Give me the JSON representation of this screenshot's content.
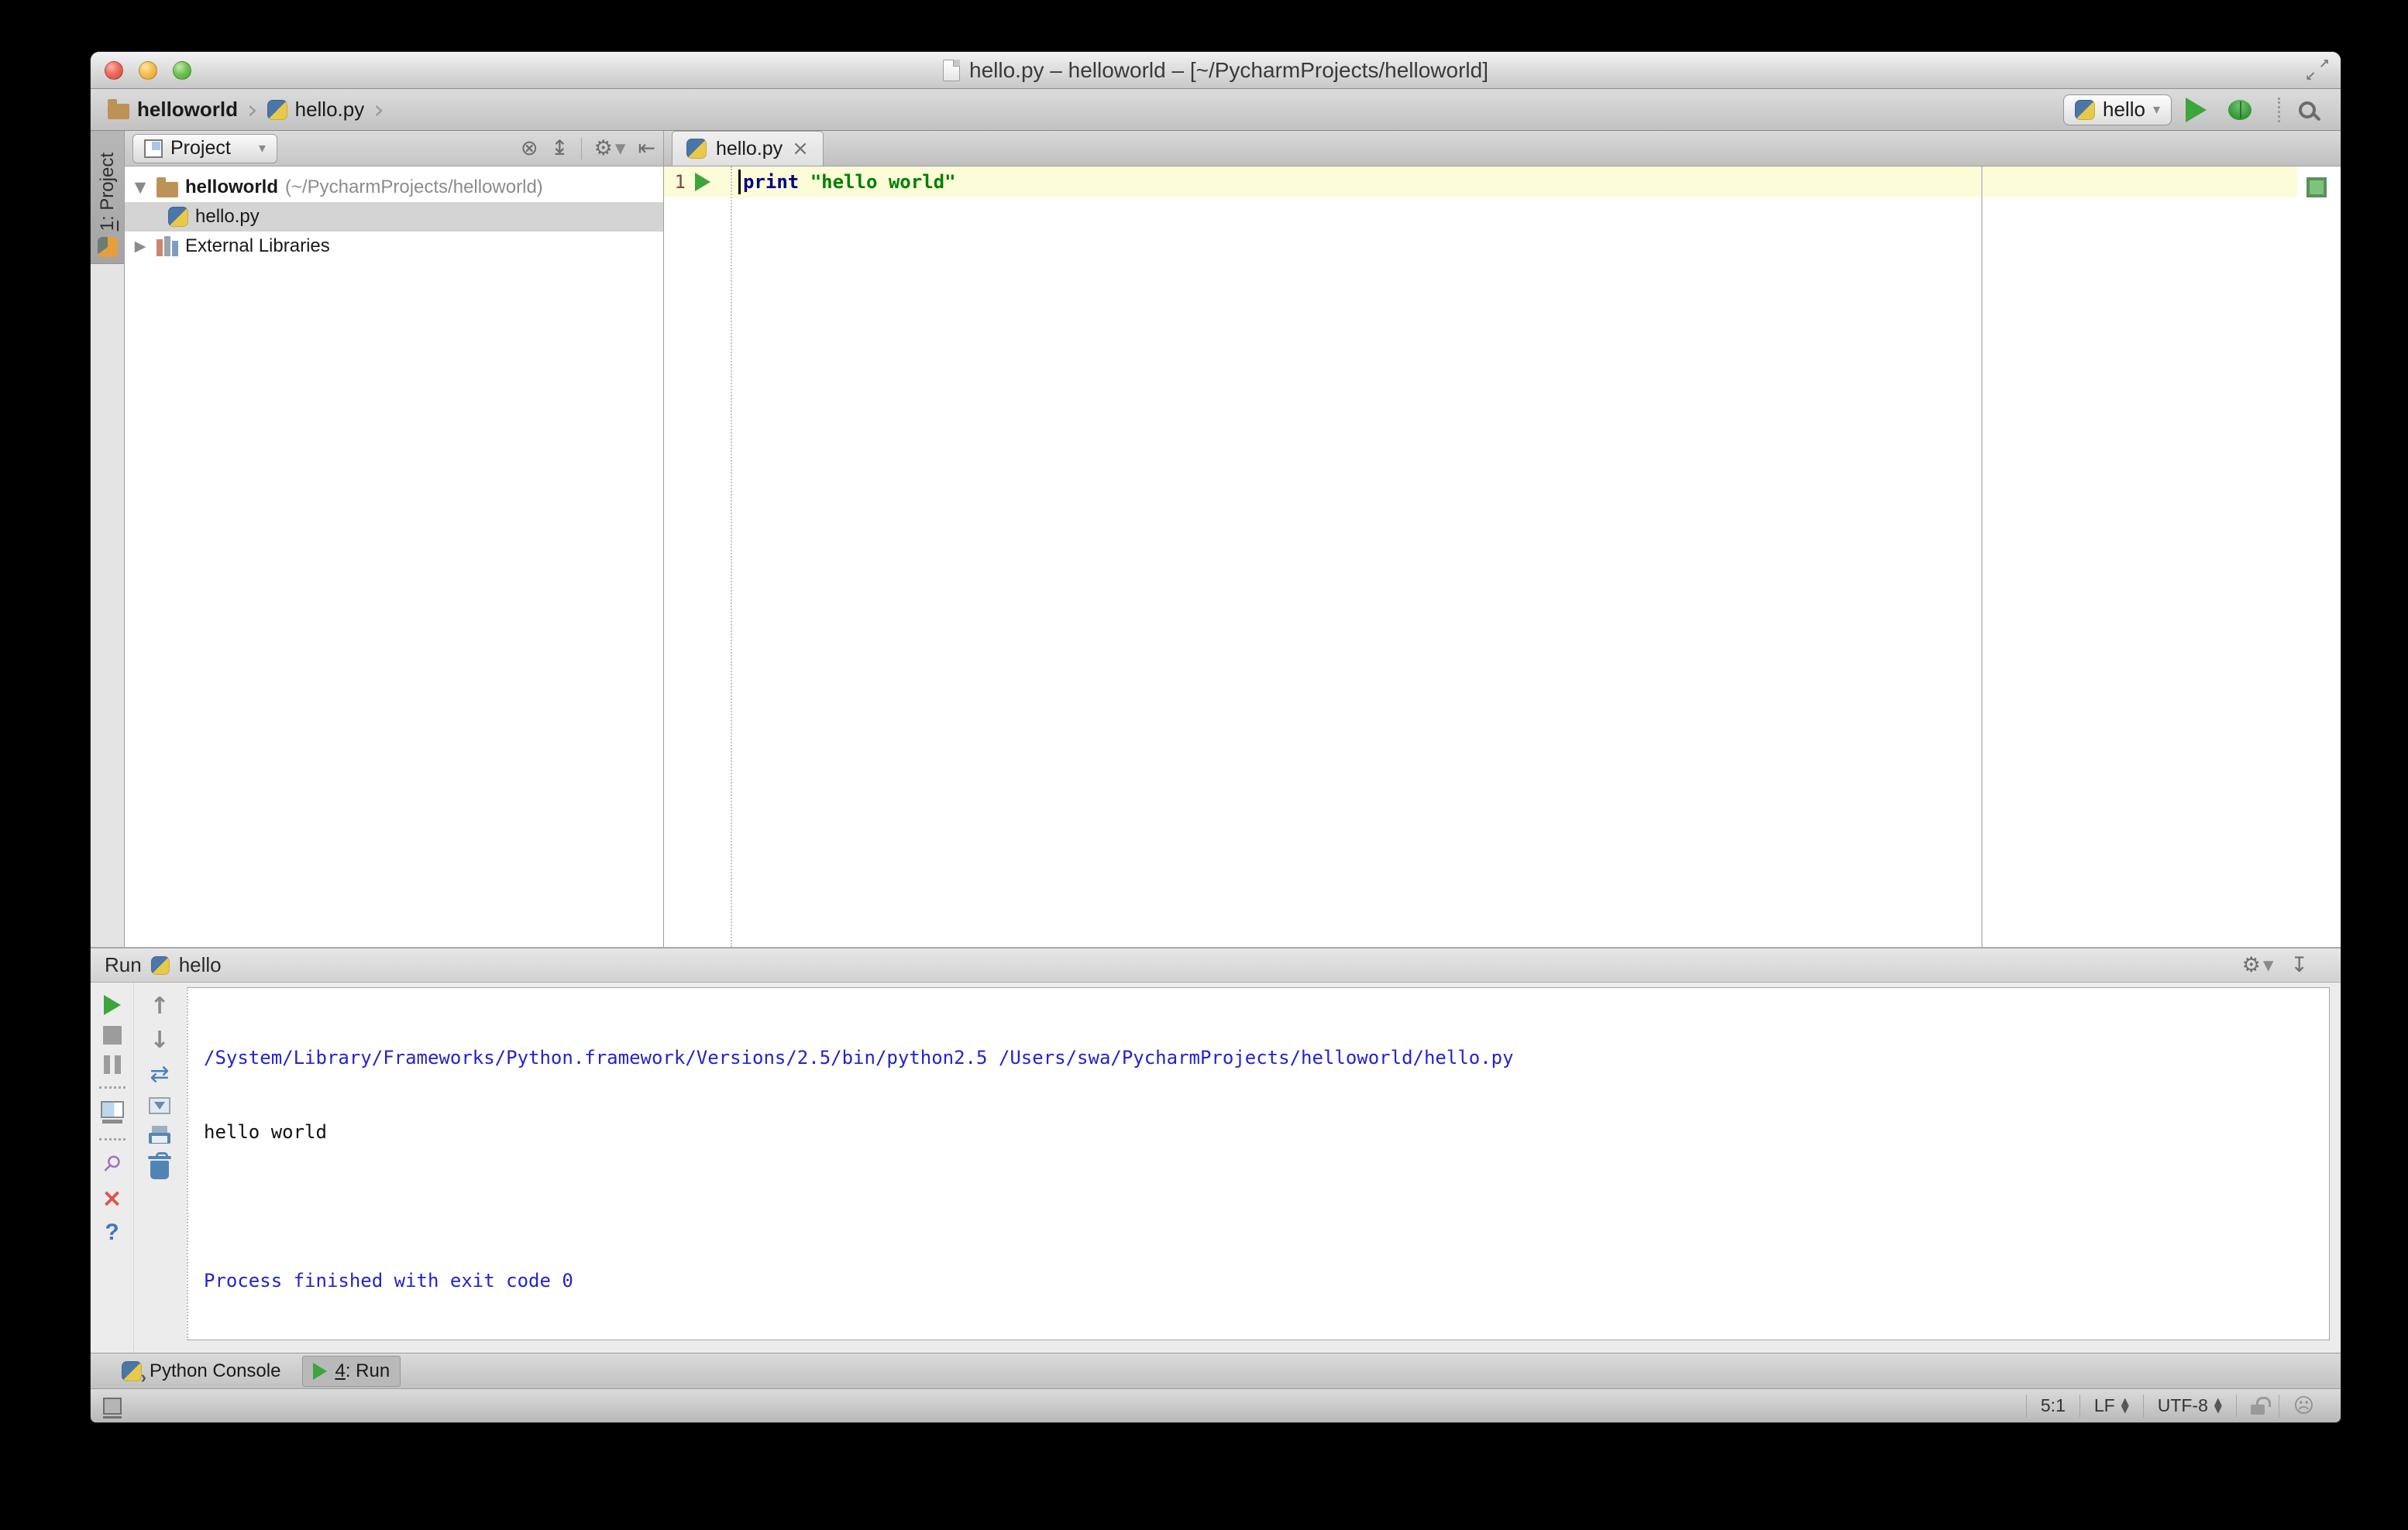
{
  "titlebar": {
    "title": "hello.py – helloworld – [~/PycharmProjects/helloworld]"
  },
  "toolbar": {
    "breadcrumb_project": "helloworld",
    "breadcrumb_file": "hello.py",
    "run_config_name": "hello"
  },
  "left_stripe": {
    "tab_mnemonic": "1",
    "tab_rest": ": Project"
  },
  "project_panel": {
    "title": "Project",
    "tree": {
      "root_name": "helloworld",
      "root_path": "(~/PycharmProjects/helloworld)",
      "file_name": "hello.py",
      "libraries_label": "External Libraries"
    }
  },
  "editor": {
    "tab_label": "hello.py",
    "line_number": "1",
    "code_keyword": "print",
    "code_string": "\"hello world\""
  },
  "run_panel": {
    "title": "Run",
    "config_name": "hello",
    "console": {
      "line1": "/System/Library/Frameworks/Python.framework/Versions/2.5/bin/python2.5 /Users/swa/PycharmProjects/helloworld/hello.py",
      "line2": "hello world",
      "line3": "",
      "line4": "Process finished with exit code 0"
    },
    "help_label": "?"
  },
  "bottom_bar": {
    "python_console_label": "Python Console",
    "run_tab_mnemonic": "4",
    "run_tab_rest": ": Run"
  },
  "status_bar": {
    "caret_position": "5:1",
    "line_separator": "LF",
    "encoding": "UTF-8"
  },
  "icons": {
    "chevron": "›",
    "dropdown": "▾",
    "locate": "⊕",
    "collapse_all": "↨",
    "gear": "⚙",
    "hide_side": "⇤",
    "caret_expanded": "▼",
    "caret_collapsed": "▶",
    "close": "×",
    "dock_down": "↧",
    "arrow_up": "↑",
    "arrow_down": "↓",
    "soft_wrap": "⇄",
    "pin": "⚲",
    "inspector_face": "☹",
    "tri_up": "▲",
    "tri_down": "▼",
    "arrow_ne": "↗",
    "arrow_sw": "↙"
  },
  "colors": {
    "run_green": "#3CA53C",
    "console_info_blue": "#2323CC",
    "keyword_blue": "#000080",
    "string_green": "#008000",
    "current_line_bg": "#FCFCD9",
    "tree_selection_gray": "#D4D4D4",
    "inspection_ok_green": "#7CC47C"
  }
}
